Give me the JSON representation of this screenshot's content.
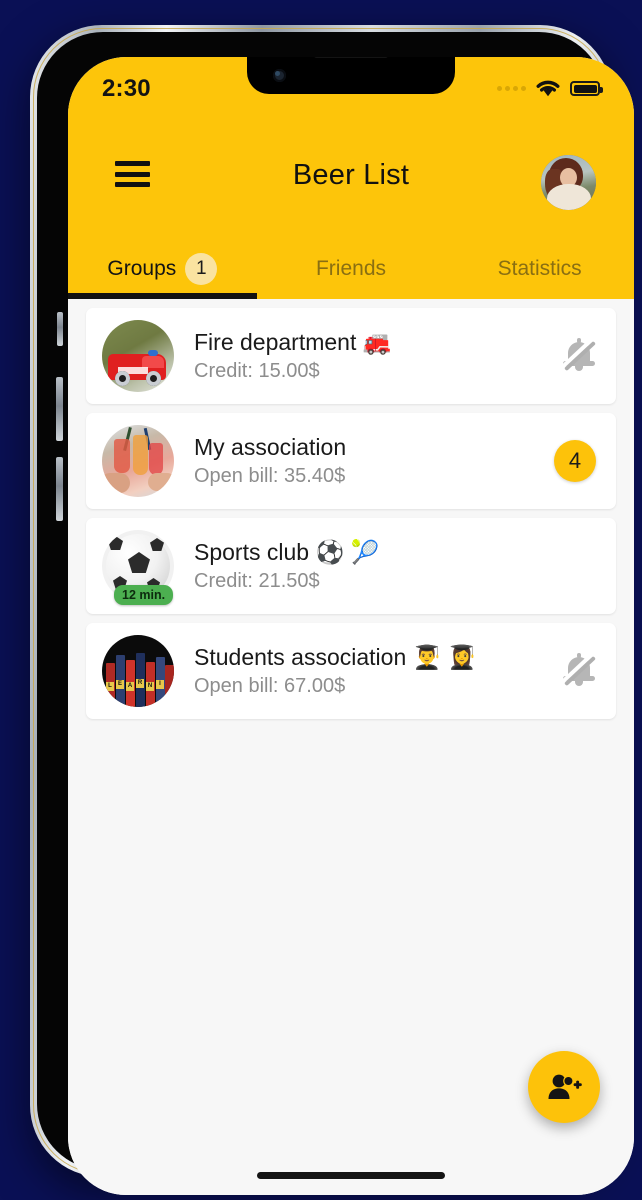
{
  "status_bar": {
    "time": "2:30",
    "signal_icon": "signal-dots-icon",
    "wifi_icon": "wifi-icon",
    "battery_icon": "battery-full-icon"
  },
  "app_bar": {
    "menu_icon": "hamburger-menu-icon",
    "title": "Beer List",
    "avatar_icon": "user-avatar-icon"
  },
  "tabs": [
    {
      "label": "Groups",
      "active": true,
      "badge": "1"
    },
    {
      "label": "Friends",
      "active": false,
      "badge": null
    },
    {
      "label": "Statistics",
      "active": false,
      "badge": null
    }
  ],
  "groups": [
    {
      "name": "Fire department 🚒",
      "subtitle": "Credit: 15.00$",
      "trailing_type": "bell-off",
      "trailing_icon": "bell-off-icon",
      "badge": null,
      "time_pill": null,
      "avatar_icon": "fire-truck-photo"
    },
    {
      "name": "My association",
      "subtitle": "Open bill: 35.40$",
      "trailing_type": "badge",
      "trailing_icon": null,
      "badge": "4",
      "time_pill": null,
      "avatar_icon": "cocktails-photo"
    },
    {
      "name": "Sports club ⚽ 🎾",
      "subtitle": "Credit: 21.50$",
      "trailing_type": "none",
      "trailing_icon": null,
      "badge": null,
      "time_pill": "12 min.",
      "avatar_icon": "soccer-ball-photo"
    },
    {
      "name": "Students association 👨‍🎓 👩‍🎓",
      "subtitle": "Open bill: 67.00$",
      "trailing_type": "bell-off",
      "trailing_icon": "bell-off-icon",
      "badge": null,
      "time_pill": null,
      "avatar_icon": "books-photo"
    }
  ],
  "fab": {
    "icon": "person-add-icon"
  },
  "colors": {
    "brand_yellow": "#FDC50A",
    "badge_yellow": "#FDC20A",
    "tab_badge_yellow": "#FAE3A0",
    "time_pill_green": "#4CAF50",
    "page_background": "#F7F7F7",
    "card_white": "#FFFFFF",
    "backdrop_navy": "#0A1055",
    "subtitle_gray": "#8D8D8D"
  }
}
